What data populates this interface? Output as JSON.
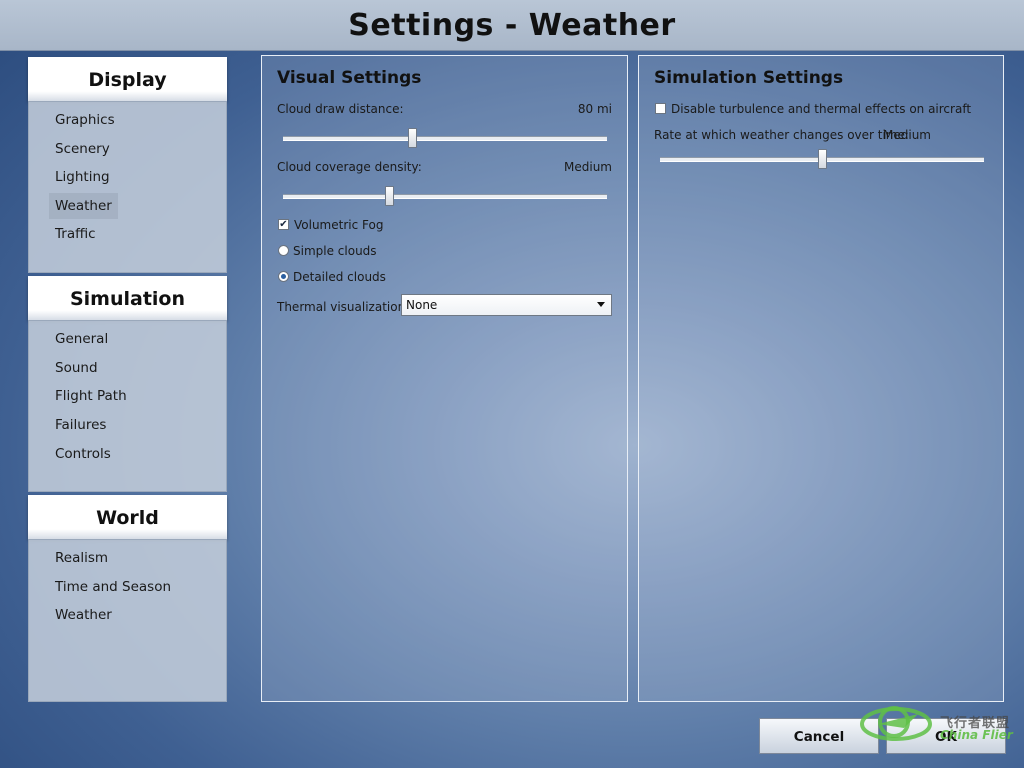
{
  "title": "Settings - Weather",
  "sidebar": {
    "groups": [
      {
        "heading": "Display",
        "items": [
          "Graphics",
          "Scenery",
          "Lighting",
          "Weather",
          "Traffic"
        ],
        "active": "Weather"
      },
      {
        "heading": "Simulation",
        "items": [
          "General",
          "Sound",
          "Flight Path",
          "Failures",
          "Controls"
        ]
      },
      {
        "heading": "World",
        "items": [
          "Realism",
          "Time and Season",
          "Weather"
        ]
      }
    ]
  },
  "visual": {
    "title": "Visual Settings",
    "cloud_draw_label": "Cloud draw distance:",
    "cloud_draw_value": "80 mi",
    "cloud_draw_level": 0.4,
    "cloud_density_label": "Cloud coverage density:",
    "cloud_density_value": "Medium",
    "cloud_density_level": 0.33,
    "volumetric_fog_label": "Volumetric Fog",
    "volumetric_fog_checked": true,
    "simple_clouds_label": "Simple clouds",
    "detailed_clouds_label": "Detailed clouds",
    "clouds_selected": "Detailed clouds",
    "thermal_label": "Thermal visualization:",
    "thermal_value": "None"
  },
  "simulation": {
    "title": "Simulation Settings",
    "turbulence_label": "Disable turbulence and thermal effects on aircraft",
    "turbulence_checked": false,
    "rate_label": "Rate at which weather changes over time:",
    "rate_value": "Medium",
    "rate_level": 0.5
  },
  "buttons": {
    "cancel": "Cancel",
    "ok": "OK"
  },
  "watermark": {
    "cn": "飞行者联盟",
    "en": "China Flier"
  },
  "colors": {
    "accent": "#2b5fa0",
    "watermark_green": "#5fbf46"
  }
}
